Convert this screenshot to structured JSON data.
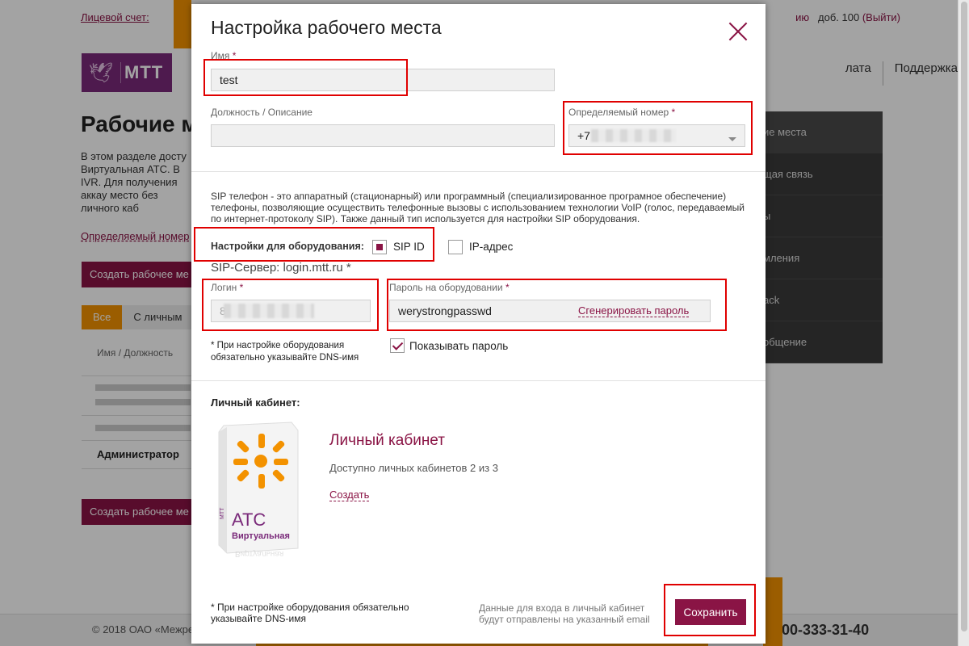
{
  "background": {
    "account_label": "Лицевой счет:",
    "ext_label": "доб. 100",
    "logout": "(Выйти)",
    "partial_link": "ию",
    "logo_text": "МТТ",
    "nav": [
      "лата",
      "Поддержка"
    ],
    "title": "Рабочие м",
    "text": "В этом разделе досту Виртуальная АТС. В IVR. Для получения аккау место без личного каб",
    "link": "Определяемый номер",
    "create_btn": "Создать рабочее ме",
    "tab_all": "Все",
    "tab_other": "С личным",
    "col_head": "Имя / Должность",
    "admin": "Администратор",
    "side_menu": [
      "ие места",
      "щая связь",
      "ы",
      "мления",
      "ack",
      "общение"
    ],
    "copyright": "© 2018 ОАО «Межре",
    "phone": "00-333-31-40"
  },
  "modal": {
    "title": "Настройка рабочего места",
    "name_label": "Имя",
    "name_value": "test",
    "position_label": "Должность / Описание",
    "position_value": "",
    "number_label": "Определяемый номер",
    "number_prefix": "+7",
    "required_mark": "*",
    "description": "SIP телефон - это аппаратный (стационарный) или программный (специализированное програмное обеспечение) телефоны, позволяющие осуществить телефонные вызовы с использованием технологии VoIP (голос, передаваемый по интернет-протоколу SIP). Также данный тип используется для настройки SIP оборудования.",
    "hw_settings_label": "Настройки для оборудования:",
    "option_sip": "SIP ID",
    "option_ip": "IP-адрес",
    "sip_server": "SIP-Сервер: login.mtt.ru *",
    "login_label": "Логин",
    "login_prefix": "8",
    "password_label": "Пароль на оборудовании",
    "password_value": "werystrongpasswd",
    "generate_link": "Сгенерировать пароль",
    "dns_note": "* При настройке оборудования обязательно указывайте DNS-имя",
    "show_password": "Показывать пароль",
    "lk_section": "Личный кабинет:",
    "lk_name": "Личный кабинет",
    "lk_available": "Доступно личных кабинетов 2 из 3",
    "lk_create": "Создать",
    "box_text_main": "АТС",
    "box_text_sub": "Виртуальная",
    "box_brand": "МТТ",
    "footer_note": "* При настройке оборудования обязательно указывайте DNS-имя",
    "footer_info": "Данные для входа в личный кабинет будут отправлены на указанный email",
    "save": "Сохранить"
  },
  "colors": {
    "brand": "#8a1445",
    "accent": "#f39200",
    "highlight": "#e00000"
  }
}
